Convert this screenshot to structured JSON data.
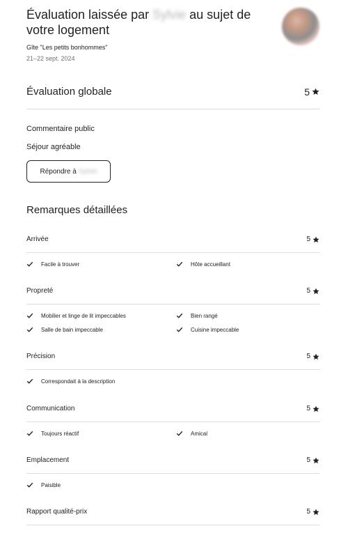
{
  "header": {
    "title_prefix": "Évaluation laissée par",
    "reviewer_name": "Sylvie",
    "title_suffix": "au sujet de",
    "title_line2": "votre logement",
    "listing": "Gîte \"Les petits bonhommes\"",
    "dates": "21–22 sept. 2024"
  },
  "overall": {
    "label": "Évaluation globale",
    "score": "5"
  },
  "comment": {
    "label": "Commentaire public",
    "text": "Séjour agréable",
    "reply_prefix": "Répondre à",
    "reply_name": "Sylvie"
  },
  "detailed": {
    "title": "Remarques détaillées",
    "categories": [
      {
        "name": "Arrivée",
        "score": "5",
        "tags": [
          "Facile à trouver",
          "Hôte accueillant"
        ]
      },
      {
        "name": "Propreté",
        "score": "5",
        "tags": [
          "Mobilier et linge de lit impeccables",
          "Bien rangé",
          "Salle de bain impeccable",
          "Cuisine impeccable"
        ]
      },
      {
        "name": "Précision",
        "score": "5",
        "tags": [
          "Correspondait à la description"
        ]
      },
      {
        "name": "Communication",
        "score": "5",
        "tags": [
          "Toujours réactif",
          "Amical"
        ]
      },
      {
        "name": "Emplacement",
        "score": "5",
        "tags": [
          "Paisible"
        ]
      },
      {
        "name": "Rapport qualité-prix",
        "score": "5",
        "tags": []
      }
    ]
  },
  "icons": {
    "star": "star-icon",
    "check": "check-icon"
  },
  "colors": {
    "text": "#222222",
    "muted": "#717171",
    "divider": "#dddddd"
  }
}
